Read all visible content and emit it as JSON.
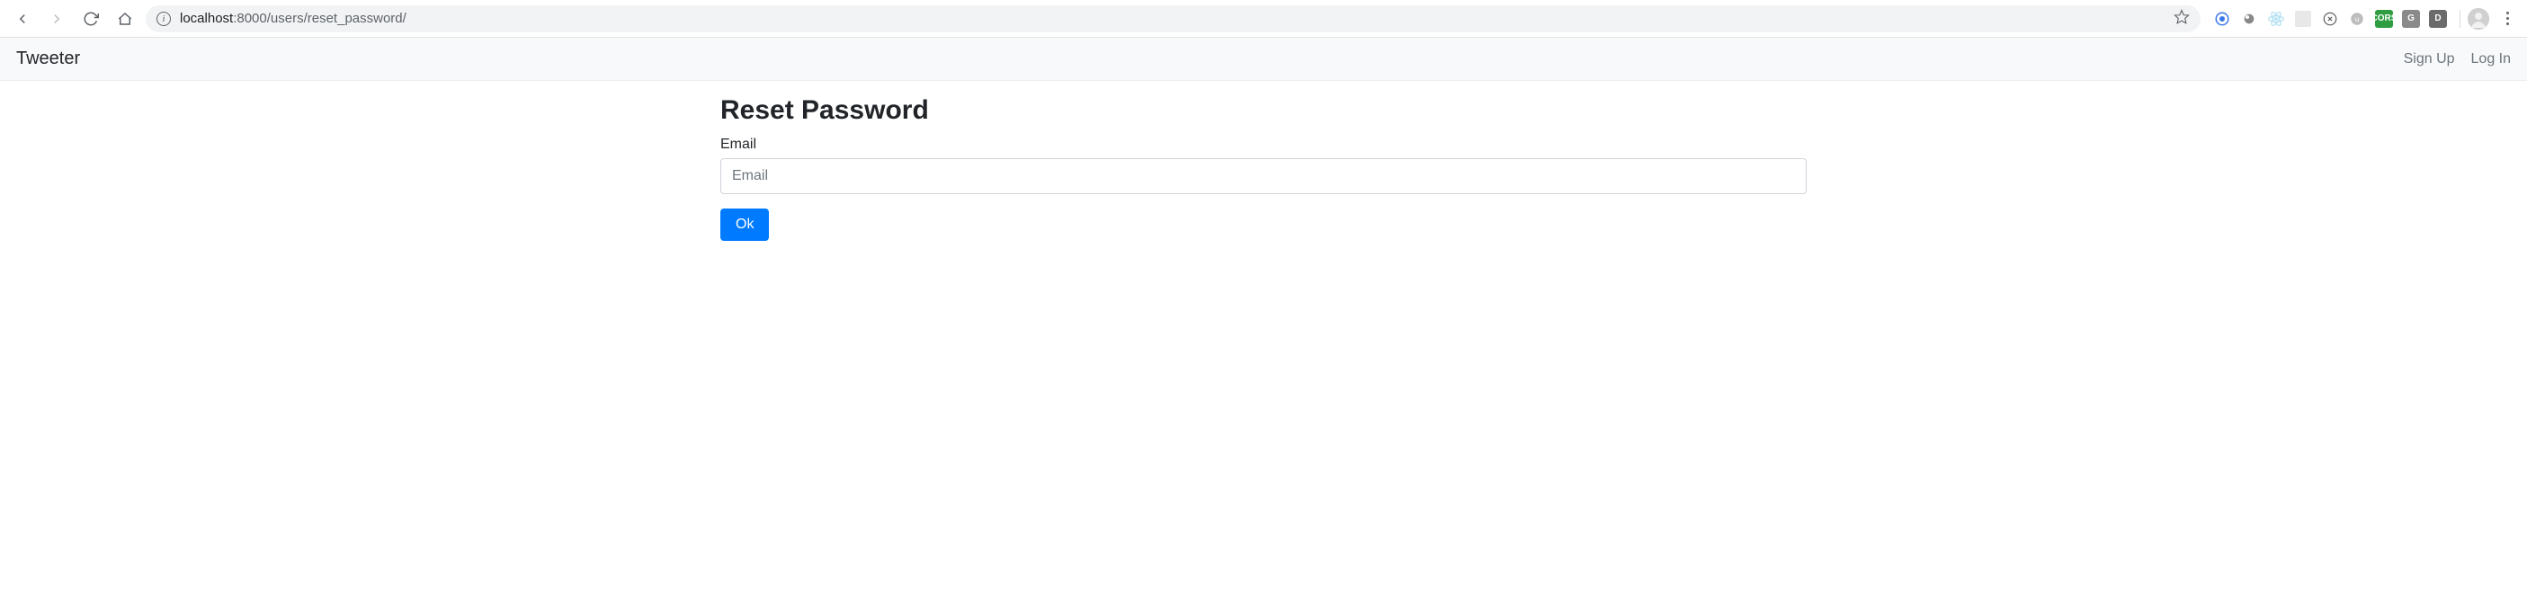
{
  "browser": {
    "url_prefix": "localhost",
    "url_port_path": ":8000/users/reset_password/",
    "info_glyph": "i"
  },
  "nav": {
    "brand": "Tweeter",
    "signup": "Sign Up",
    "login": "Log In"
  },
  "page": {
    "title": "Reset Password",
    "email_label": "Email",
    "email_placeholder": "Email",
    "submit_label": "Ok"
  },
  "ext": {
    "cors_label": "CORS",
    "g_label": "G",
    "d_label": "D"
  }
}
